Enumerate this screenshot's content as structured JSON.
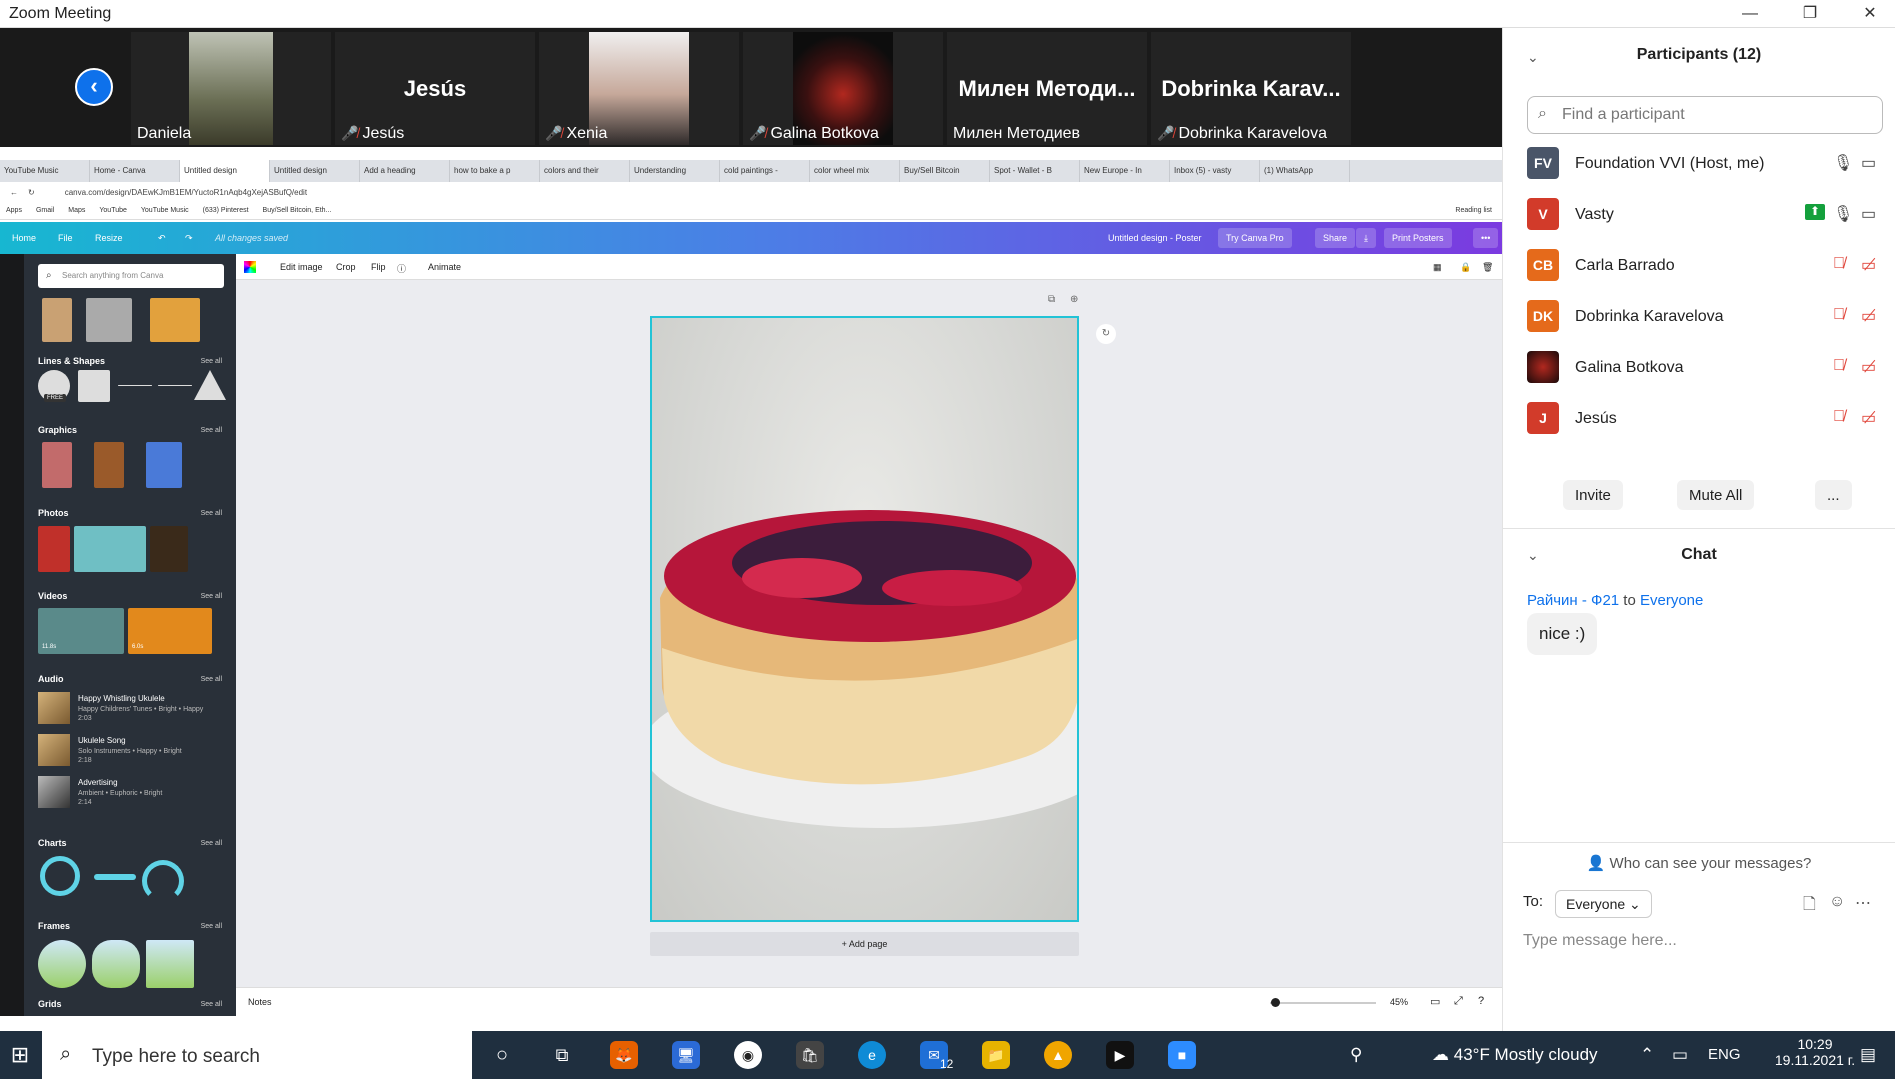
{
  "window": {
    "title": "Zoom Meeting"
  },
  "video_strip": {
    "tiles": [
      {
        "name": "Daniela",
        "muted": false
      },
      {
        "name": "Jesús",
        "big": "Jesús",
        "muted": true
      },
      {
        "name": "Xenia",
        "muted": true
      },
      {
        "name": "Galina Botkova",
        "muted": true
      },
      {
        "name": "Милен Методиев",
        "big": "Милен Методи...",
        "muted": false
      },
      {
        "name": "Dobrinka Karavelova",
        "big": "Dobrinka Karav...",
        "muted": true
      }
    ]
  },
  "browser": {
    "tabs": [
      "YouTube Music",
      "Home - Canva",
      "Untitled design",
      "Untitled design",
      "Add a heading",
      "how to bake a p",
      "colors and their",
      "Understanding",
      "cold paintings -",
      "color wheel mix",
      "Buy/Sell Bitcoin",
      "Spot - Wallet - B",
      "New Europe - In",
      "Inbox (5) - vasty",
      "(1) WhatsApp"
    ],
    "url": "canva.com/design/DAEwKJmB1EM/YuctoR1nAqb4gXejASBufQ/edit",
    "bookmarks": [
      "Apps",
      "Gmail",
      "Maps",
      "YouTube",
      "YouTube Music",
      "(633) Pinterest",
      "Buy/Sell Bitcoin, Eth..."
    ],
    "reading_list": "Reading list"
  },
  "canva": {
    "topbar": {
      "home": "Home",
      "file": "File",
      "resize": "Resize",
      "saved": "All changes saved",
      "design_name": "Untitled design - Poster",
      "try_pro": "Try Canva Pro",
      "share": "Share",
      "print": "Print Posters"
    },
    "panel": {
      "search_placeholder": "Search anything from Canva",
      "sections": [
        "Lines & Shapes",
        "Graphics",
        "Photos",
        "Videos",
        "Audio",
        "Charts",
        "Frames",
        "Grids"
      ],
      "see_all": "See all",
      "free_badge": "FREE",
      "video_durations": [
        "11.8s",
        "6.0s"
      ],
      "audio": [
        {
          "title": "Happy Whistling Ukulele",
          "meta": "Happy Childrens' Tunes • Bright • Happy",
          "dur": "2:03"
        },
        {
          "title": "Ukulele Song",
          "meta": "Solo Instruments • Happy • Bright",
          "dur": "2:18"
        },
        {
          "title": "Advertising",
          "meta": "Ambient • Euphoric • Bright",
          "dur": "2:14"
        }
      ]
    },
    "toolbar": {
      "edit_image": "Edit image",
      "crop": "Crop",
      "flip": "Flip",
      "animate": "Animate"
    },
    "add_page": "+ Add page",
    "notes": "Notes",
    "zoom": "45%"
  },
  "participants": {
    "title": "Participants (12)",
    "find_placeholder": "Find a participant",
    "list": [
      {
        "initials": "FV",
        "name": "Foundation VVI (Host, me)",
        "color": "#4a5568",
        "muted": false
      },
      {
        "initials": "V",
        "name": "Vasty",
        "color": "#d23b2a",
        "muted": false
      },
      {
        "initials": "CB",
        "name": "Carla Barrado",
        "color": "#e56a1b",
        "muted": true
      },
      {
        "initials": "DK",
        "name": "Dobrinka Karavelova",
        "color": "#e56a1b",
        "muted": true
      },
      {
        "initials": "",
        "name": "Galina Botkova",
        "color": "#3a2a2a",
        "muted": true
      },
      {
        "initials": "J",
        "name": "Jesús",
        "color": "#d23b2a",
        "muted": true
      }
    ],
    "invite": "Invite",
    "mute_all": "Mute All",
    "more": "..."
  },
  "chat": {
    "title": "Chat",
    "sender": "Райчин - Ф21",
    "to_word": "to",
    "recipient": "Everyone",
    "message": "nice :)",
    "who_can_see": "Who can see your messages?",
    "to_label": "To:",
    "to_select": "Everyone",
    "placeholder": "Type message here..."
  },
  "taskbar": {
    "search_placeholder": "Type here to search",
    "weather": "43°F  Mostly cloudy",
    "lang": "ENG",
    "time": "10:29",
    "date": "19.11.2021 г.",
    "mail_badge": "12"
  }
}
